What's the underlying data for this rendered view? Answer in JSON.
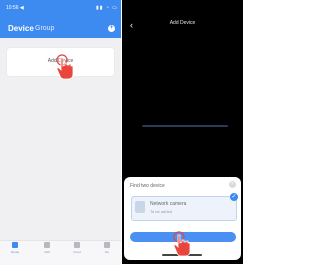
{
  "left": {
    "status": {
      "time": "10:56 ◀",
      "icons": "▮▮ ◔ ▭"
    },
    "header": {
      "tab_device": "Device",
      "tab_group": "Group",
      "add_icon": "add-circle-icon"
    },
    "add_device_text": "Add Device",
    "tabbar": [
      {
        "label": "Home",
        "icon": "home-icon"
      },
      {
        "label": "Mall",
        "icon": "mall-icon"
      },
      {
        "label": "Cloud",
        "icon": "cloud-icon"
      },
      {
        "label": "Me",
        "icon": "user-icon"
      }
    ]
  },
  "right": {
    "title": "Add Device",
    "back_icon": "‹",
    "sheet": {
      "title": "Find two device",
      "close_icon": "×",
      "device_name": "Network camera",
      "device_status": "To be added",
      "check_icon": "✓"
    }
  },
  "colors": {
    "accent": "#3d8bf0",
    "right_bg": "#000000",
    "left_bg": "#f0f0f3"
  }
}
